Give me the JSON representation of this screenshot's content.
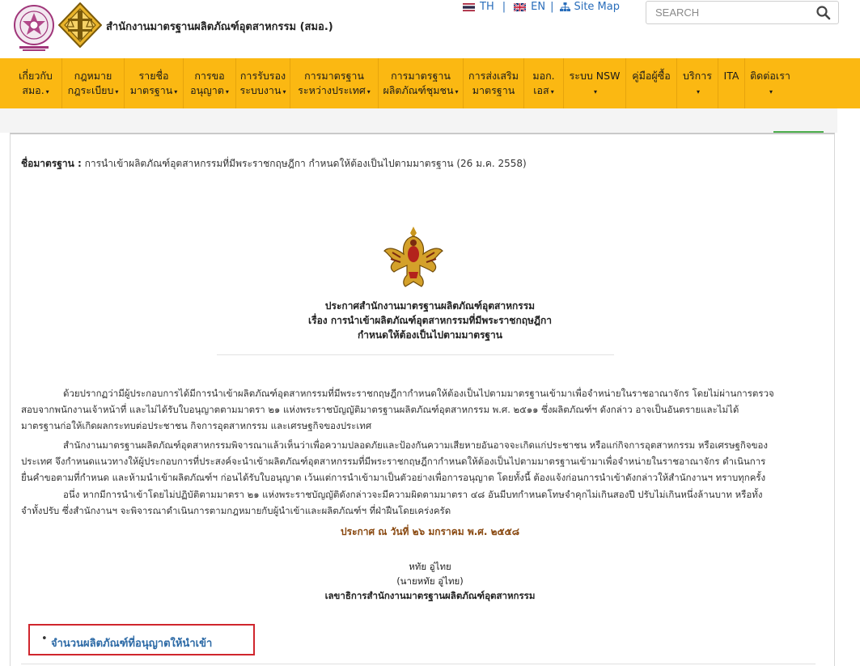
{
  "header": {
    "site_name": "สำนักงานมาตรฐานผลิตภัณฑ์อุตสาหกรรม (สมอ.)",
    "lang_th": "TH",
    "lang_en": "EN",
    "sitemap": "Site Map",
    "separator": "|",
    "search_placeholder": "SEARCH",
    "logos": [
      "ministry-of-industry-seal",
      "tisi-logo"
    ],
    "icons": [
      "thai-flag-icon",
      "uk-flag-icon",
      "sitemap-icon",
      "search-icon"
    ]
  },
  "nav": {
    "items": [
      {
        "l1": "เกี่ยวกับ",
        "l2": "สมอ."
      },
      {
        "l1": "กฎหมาย",
        "l2": "กฎระเบียบ"
      },
      {
        "l1": "รายชื่อ",
        "l2": "มาตรฐาน"
      },
      {
        "l1": "การขอ",
        "l2": "อนุญาต"
      },
      {
        "l1": "การรับรอง",
        "l2": "ระบบงาน"
      },
      {
        "l1": "การมาตรฐาน",
        "l2": "ระหว่างประเทศ"
      },
      {
        "l1": "การมาตรฐาน",
        "l2": "ผลิตภัณฑ์ชุมชน"
      },
      {
        "l1": "การส่งเสริม",
        "l2": "มาตรฐาน"
      },
      {
        "l1": "มอก.",
        "l2": "เอส"
      },
      {
        "l1": "ระบบ NSW",
        "l2": ""
      },
      {
        "l1": "คู่มือผู้ซื้อ",
        "l2": ""
      },
      {
        "l1": "บริการ",
        "l2": ""
      },
      {
        "l1": "ITA",
        "l2": ""
      },
      {
        "l1": "ติดต่อเรา",
        "l2": ""
      }
    ],
    "caret": "▾"
  },
  "content": {
    "std_label": "ชื่อมาตรฐาน :",
    "std_value": "การนำเข้าผลิตภัณฑ์อุตสาหกรรมที่มีพระราชกฤษฎีกา กำหนดให้ต้องเป็นไปตามมาตรฐาน (26 ม.ค. 2558)",
    "emblem": "garuda-emblem",
    "ann_title1": "ประกาศสำนักงานมาตรฐานผลิตภัณฑ์อุตสาหกรรม",
    "ann_title2": "เรื่อง การนำเข้าผลิตภัณฑ์อุตสาหกรรมที่มีพระราชกฤษฎีกา",
    "ann_title3": "กำหนดให้ต้องเป็นไปตามมาตรฐาน",
    "p1": [
      "ด้วยปรากฏว่ามีผู้ประกอบการได้มีการนำเข้าผลิตภัณฑ์อุตสาหกรรมที่มีพระราชกฤษฎีกากำหนดให้ต้องเป็นไปตามมาตรฐานเข้ามาเพื่อจำหน่ายในราชอาณาจักร โดยไม่ผ่านการตรวจ",
      "สอบจากพนักงานเจ้าหน้าที่ และไม่ได้รับใบอนุญาตตามมาตรา ๒๑ แห่งพระราชบัญญัติมาตรฐานผลิตภัณฑ์อุตสาหกรรม พ.ศ. ๒๕๑๑ ซึ่งผลิตภัณฑ์ฯ ดังกล่าว อาจเป็นอันตรายและไม่ได้",
      "มาตรฐานก่อให้เกิดผลกระทบต่อประชาชน กิจการอุตสาหกรรม และเศรษฐกิจของประเทศ"
    ],
    "p2": [
      "สำนักงานมาตรฐานผลิตภัณฑ์อุตสาหกรรมพิจารณาแล้วเห็นว่าเพื่อความปลอดภัยและป้องกันความเสียหายอันอาจจะเกิดแก่ประชาชน หรือแก่กิจการอุตสาหกรรม หรือเศรษฐกิจของ",
      "ประเทศ จึงกำหนดแนวทางให้ผู้ประกอบการที่ประสงค์จะนำเข้าผลิตภัณฑ์อุตสาหกรรมที่มีพระราชกฤษฎีกากำหนดให้ต้องเป็นไปตามมาตรฐานเข้ามาเพื่อจำหน่ายในราชอาณาจักร ดำเนินการ",
      "ยื่นคำขอตามที่กำหนด และห้ามนำเข้าผลิตภัณฑ์ฯ ก่อนได้รับใบอนุญาต เว้นแต่การนำเข้ามาเป็นตัวอย่างเพื่อการอนุญาต โดยทั้งนี้ ต้องแจ้งก่อนการนำเข้าดังกล่าวให้สำนักงานฯ ทราบทุกครั้ง"
    ],
    "p3": [
      "อนึ่ง หากมีการนำเข้าโดยไม่ปฏิบัติตามมาตรา ๒๑ แห่งพระราชบัญญัติดังกล่าวจะมีความผิดตามมาตรา ๔๘ อันมีบทกำหนดโทษจำคุกไม่เกินสองปี ปรับไม่เกินหนึ่งล้านบาท หรือทั้ง",
      "จำทั้งปรับ ซึ่งสำนักงานฯ จะพิจารณาดำเนินการตามกฎหมายกับผู้นำเข้าและผลิตภัณฑ์ฯ ที่ฝ่าฝืนโดยเคร่งครัด"
    ],
    "announce_date": "ประกาศ ณ วันที่ ๒๖ มกราคม พ.ศ. ๒๕๕๘",
    "signer_name": "หทัย อู่ไทย",
    "signer_full": "(นายหทัย อู่ไทย)",
    "signer_title": "เลขาธิการสำนักงานมาตรฐานผลิตภัณฑ์อุตสาหกรรม",
    "link_bullet": "•",
    "link_text": "จำนวนผลิตภัณฑ์ที่อนุญาตให้นำเข้า"
  },
  "colors": {
    "nav_bg": "#fbb812",
    "link": "#2d6aa6",
    "date": "#8a4a12",
    "highlight_border": "#d0262d",
    "green": "#4cae4c"
  }
}
